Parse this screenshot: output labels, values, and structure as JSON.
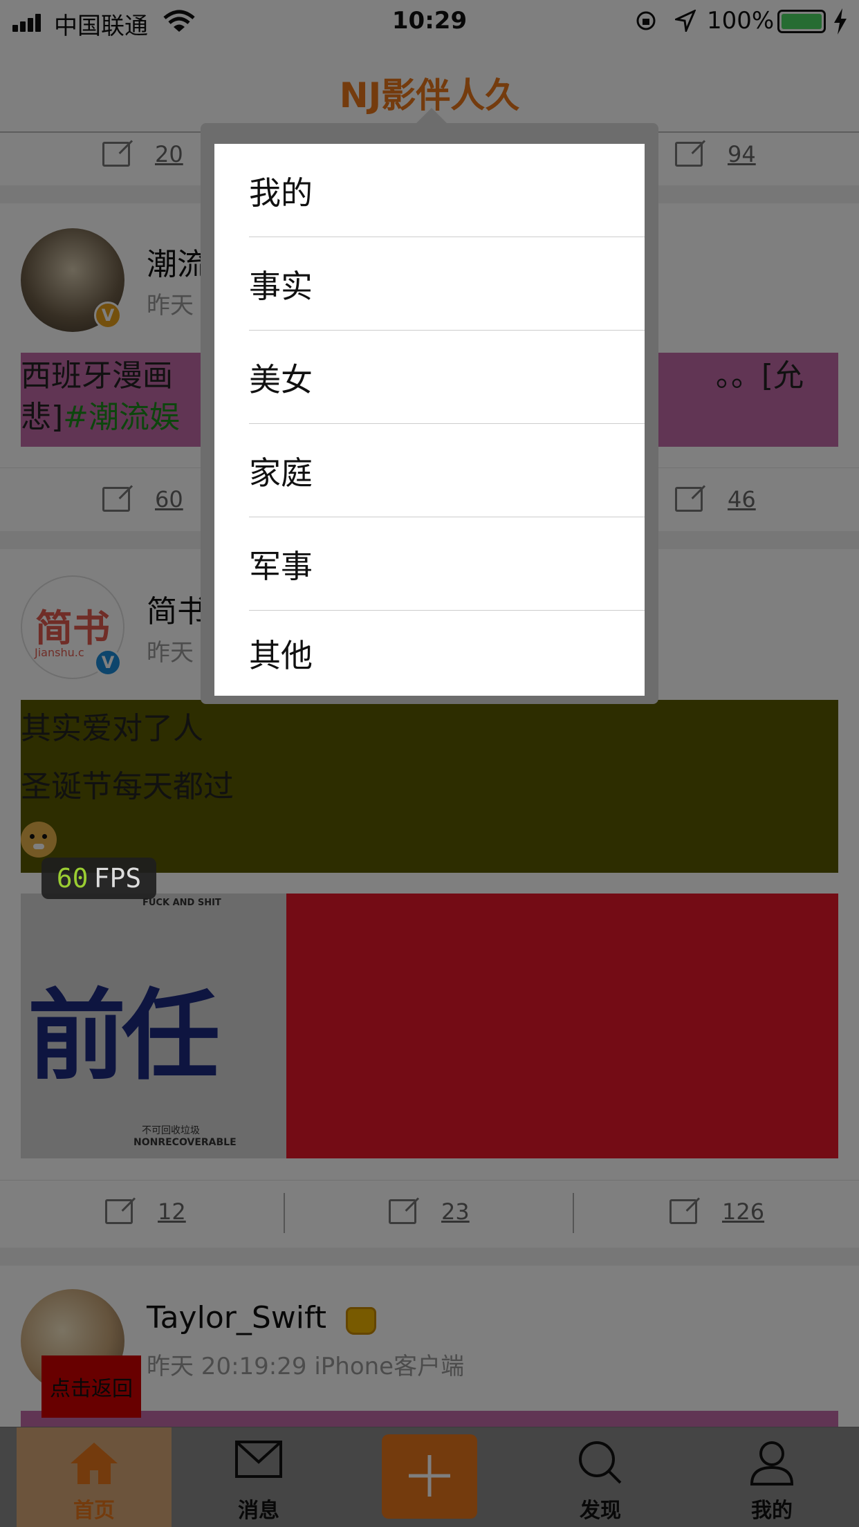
{
  "status_bar": {
    "carrier": "中国联通",
    "time": "10:29",
    "battery_pct": "100%"
  },
  "nav": {
    "title": "NJ影伴人久"
  },
  "posts": [
    {
      "actions": [
        "20",
        "94"
      ]
    },
    {
      "name": "潮流",
      "time": "昨天",
      "text": "西班牙漫画",
      "text_end": "。。[允",
      "text_line2": "悲]",
      "hashtag": "#潮流娱",
      "actions": [
        "60",
        "46"
      ]
    },
    {
      "name": "简书",
      "time": "昨天",
      "avatar_text": "简书",
      "avatar_sub": "Jianshu.c",
      "line1": "其实爱对了人",
      "line2": "圣诞节每天都过",
      "image_text": "前任",
      "image_top": "FUCK AND SHIT",
      "image_sub1": "不可回收垃圾",
      "image_sub2": "NONRECOVERABLE",
      "actions": [
        "12",
        "23",
        "126"
      ]
    },
    {
      "name": "Taylor_Swift",
      "time": "昨天 20:19:29  iPhone客户端",
      "back_button": "点击返回"
    }
  ],
  "menu": {
    "items": [
      "我的",
      "事实",
      "美女",
      "家庭",
      "军事",
      "其他"
    ]
  },
  "fps": {
    "value": "60",
    "unit": "FPS"
  },
  "tabbar": {
    "tabs": [
      "首页",
      "消息",
      "发现",
      "我的"
    ]
  },
  "colors": {
    "accent": "#E8761B",
    "pink_block": "#c26aa8",
    "olive_block": "#5a5a00",
    "red_block": "#e8182a",
    "back_button": "#d00000"
  }
}
